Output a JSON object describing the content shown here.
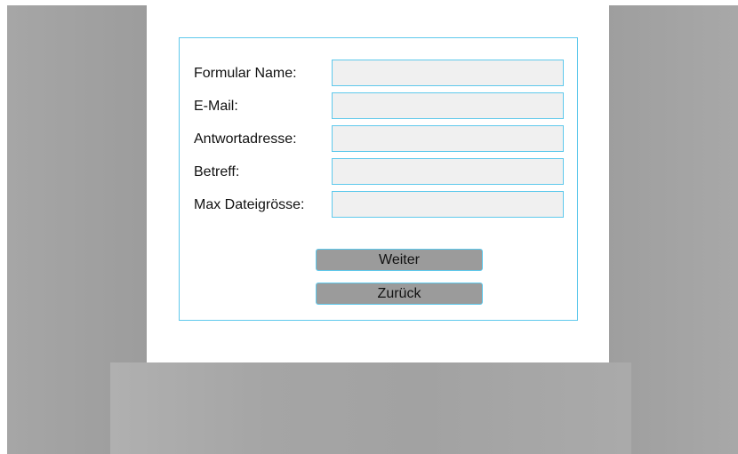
{
  "form": {
    "fields": [
      {
        "label": "Formular Name:",
        "value": ""
      },
      {
        "label": "E-Mail:",
        "value": ""
      },
      {
        "label": "Antwortadresse:",
        "value": ""
      },
      {
        "label": "Betreff:",
        "value": ""
      },
      {
        "label": "Max Dateigrösse:",
        "value": ""
      }
    ],
    "buttons": {
      "next_label": "Weiter",
      "back_label": "Zurück"
    }
  },
  "colors": {
    "accent_border": "#5fc9ec",
    "input_bg": "#f0f0f0",
    "button_bg": "#9b9b9b",
    "backdrop": "#a3a3a3"
  }
}
